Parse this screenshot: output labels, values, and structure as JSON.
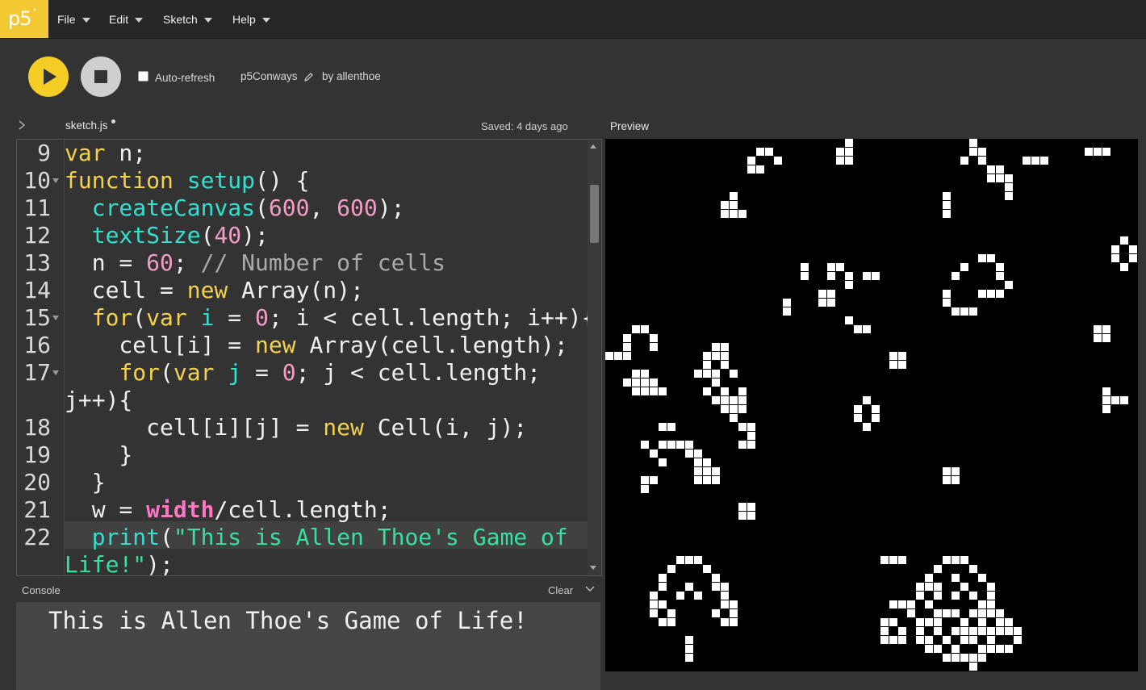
{
  "app": {
    "logo_text": "p5",
    "logo_mark": "*"
  },
  "menu": {
    "file": "File",
    "edit": "Edit",
    "sketch": "Sketch",
    "help": "Help"
  },
  "toolbar": {
    "auto_refresh_label": "Auto-refresh",
    "auto_refresh_checked": false,
    "sketch_name": "p5Conways",
    "author": "by allenthoe"
  },
  "editor": {
    "tab_name": "sketch.js",
    "saved_status": "Saved: 4 days ago",
    "lines": [
      {
        "n": "9",
        "tokens": [
          [
            "kw",
            "var"
          ],
          [
            "pl",
            " n;"
          ]
        ]
      },
      {
        "n": "10",
        "fold": true,
        "tokens": [
          [
            "kw",
            "function"
          ],
          [
            "pl",
            " "
          ],
          [
            "fn",
            "setup"
          ],
          [
            "pl",
            "() {"
          ]
        ]
      },
      {
        "n": "11",
        "tokens": [
          [
            "pl",
            "  "
          ],
          [
            "fn",
            "createCanvas"
          ],
          [
            "pl",
            "("
          ],
          [
            "num",
            "600"
          ],
          [
            "pl",
            ", "
          ],
          [
            "num",
            "600"
          ],
          [
            "pl",
            ");"
          ]
        ]
      },
      {
        "n": "12",
        "tokens": [
          [
            "pl",
            "  "
          ],
          [
            "fn",
            "textSize"
          ],
          [
            "pl",
            "("
          ],
          [
            "num",
            "40"
          ],
          [
            "pl",
            ");"
          ]
        ]
      },
      {
        "n": "13",
        "tokens": [
          [
            "pl",
            "  n = "
          ],
          [
            "num",
            "60"
          ],
          [
            "pl",
            "; "
          ],
          [
            "cm",
            "// Number of cells"
          ]
        ]
      },
      {
        "n": "14",
        "tokens": [
          [
            "pl",
            "  cell = "
          ],
          [
            "kw",
            "new"
          ],
          [
            "pl",
            " Array(n);"
          ]
        ]
      },
      {
        "n": "15",
        "fold": true,
        "tokens": [
          [
            "pl",
            "  "
          ],
          [
            "kw",
            "for"
          ],
          [
            "pl",
            "("
          ],
          [
            "kw",
            "var"
          ],
          [
            "pl",
            " "
          ],
          [
            "var",
            "i"
          ],
          [
            "pl",
            " = "
          ],
          [
            "num",
            "0"
          ],
          [
            "pl",
            "; i < cell.length; i++){"
          ]
        ]
      },
      {
        "n": "16",
        "tokens": [
          [
            "pl",
            "    cell[i] = "
          ],
          [
            "kw",
            "new"
          ],
          [
            "pl",
            " Array(cell.length);"
          ]
        ]
      },
      {
        "n": "17",
        "fold": true,
        "tokens": [
          [
            "pl",
            "    "
          ],
          [
            "kw",
            "for"
          ],
          [
            "pl",
            "("
          ],
          [
            "kw",
            "var"
          ],
          [
            "pl",
            " "
          ],
          [
            "var",
            "j"
          ],
          [
            "pl",
            " = "
          ],
          [
            "num",
            "0"
          ],
          [
            "pl",
            "; j < cell.length;"
          ]
        ]
      },
      {
        "n": "",
        "tokens": [
          [
            "pl",
            "j++){"
          ]
        ]
      },
      {
        "n": "18",
        "tokens": [
          [
            "pl",
            "      cell[i][j] = "
          ],
          [
            "kw",
            "new"
          ],
          [
            "pl",
            " Cell(i, j);"
          ]
        ]
      },
      {
        "n": "19",
        "tokens": [
          [
            "pl",
            "    }"
          ]
        ]
      },
      {
        "n": "20",
        "tokens": [
          [
            "pl",
            "  }"
          ]
        ]
      },
      {
        "n": "21",
        "tokens": [
          [
            "pl",
            "  w = "
          ],
          [
            "bi",
            "width"
          ],
          [
            "pl",
            "/cell.length;"
          ]
        ]
      },
      {
        "n": "22",
        "tokens": [
          [
            "pl",
            "  "
          ],
          [
            "fn",
            "print"
          ],
          [
            "pl",
            "("
          ],
          [
            "str",
            "\"This is Allen Thoe's Game of"
          ]
        ]
      },
      {
        "n": "",
        "tokens": [
          [
            "str",
            "Life!\""
          ],
          [
            "pl",
            ");"
          ]
        ]
      }
    ]
  },
  "console": {
    "title": "Console",
    "clear_label": "Clear",
    "output": "This is Allen Thoe's Game of Life!"
  },
  "preview": {
    "title": "Preview",
    "grid_cells": 60,
    "live_cells": [
      [
        17,
        1
      ],
      [
        18,
        1
      ],
      [
        16,
        2
      ],
      [
        19,
        2
      ],
      [
        16,
        3
      ],
      [
        17,
        3
      ],
      [
        27,
        0
      ],
      [
        26,
        1
      ],
      [
        27,
        1
      ],
      [
        26,
        2
      ],
      [
        27,
        2
      ],
      [
        41,
        0
      ],
      [
        41,
        1
      ],
      [
        42,
        1
      ],
      [
        40,
        2
      ],
      [
        42,
        2
      ],
      [
        43,
        3
      ],
      [
        44,
        3
      ],
      [
        43,
        4
      ],
      [
        44,
        4
      ],
      [
        45,
        4
      ],
      [
        45,
        5
      ],
      [
        45,
        6
      ],
      [
        47,
        2
      ],
      [
        48,
        2
      ],
      [
        49,
        2
      ],
      [
        54,
        1
      ],
      [
        55,
        1
      ],
      [
        56,
        1
      ],
      [
        14,
        6
      ],
      [
        13,
        7
      ],
      [
        14,
        7
      ],
      [
        15,
        8
      ],
      [
        13,
        8
      ],
      [
        14,
        8
      ],
      [
        38,
        6
      ],
      [
        38,
        7
      ],
      [
        38,
        8
      ],
      [
        58,
        11
      ],
      [
        57,
        12
      ],
      [
        59,
        12
      ],
      [
        57,
        13
      ],
      [
        59,
        13
      ],
      [
        58,
        14
      ],
      [
        22,
        14
      ],
      [
        22,
        15
      ],
      [
        25,
        14
      ],
      [
        26,
        14
      ],
      [
        25,
        15
      ],
      [
        27,
        15
      ],
      [
        27,
        16
      ],
      [
        29,
        15
      ],
      [
        30,
        15
      ],
      [
        24,
        17
      ],
      [
        24,
        18
      ],
      [
        25,
        18
      ],
      [
        25,
        17
      ],
      [
        20,
        18
      ],
      [
        20,
        19
      ],
      [
        27,
        20
      ],
      [
        28,
        21
      ],
      [
        29,
        21
      ],
      [
        42,
        13
      ],
      [
        43,
        13
      ],
      [
        40,
        14
      ],
      [
        44,
        14
      ],
      [
        39,
        15
      ],
      [
        44,
        15
      ],
      [
        45,
        16
      ],
      [
        42,
        17
      ],
      [
        43,
        17
      ],
      [
        44,
        17
      ],
      [
        38,
        17
      ],
      [
        38,
        18
      ],
      [
        39,
        19
      ],
      [
        40,
        19
      ],
      [
        41,
        19
      ],
      [
        3,
        21
      ],
      [
        4,
        21
      ],
      [
        2,
        22
      ],
      [
        5,
        22
      ],
      [
        2,
        23
      ],
      [
        5,
        23
      ],
      [
        1,
        24
      ],
      [
        2,
        24
      ],
      [
        0,
        24
      ],
      [
        3,
        26
      ],
      [
        4,
        26
      ],
      [
        2,
        27
      ],
      [
        3,
        27
      ],
      [
        4,
        27
      ],
      [
        5,
        27
      ],
      [
        3,
        28
      ],
      [
        4,
        28
      ],
      [
        5,
        28
      ],
      [
        6,
        28
      ],
      [
        12,
        23
      ],
      [
        13,
        23
      ],
      [
        11,
        24
      ],
      [
        12,
        24
      ],
      [
        13,
        24
      ],
      [
        10,
        26
      ],
      [
        11,
        26
      ],
      [
        12,
        26
      ],
      [
        14,
        26
      ],
      [
        11,
        25
      ],
      [
        13,
        25
      ],
      [
        12,
        27
      ],
      [
        11,
        28
      ],
      [
        13,
        28
      ],
      [
        12,
        29
      ],
      [
        13,
        29
      ],
      [
        14,
        29
      ],
      [
        13,
        30
      ],
      [
        14,
        30
      ],
      [
        15,
        30
      ],
      [
        14,
        31
      ],
      [
        15,
        28
      ],
      [
        15,
        29
      ],
      [
        55,
        21
      ],
      [
        56,
        21
      ],
      [
        55,
        22
      ],
      [
        56,
        22
      ],
      [
        32,
        24
      ],
      [
        33,
        24
      ],
      [
        32,
        25
      ],
      [
        33,
        25
      ],
      [
        56,
        28
      ],
      [
        56,
        29
      ],
      [
        57,
        29
      ],
      [
        58,
        29
      ],
      [
        56,
        30
      ],
      [
        29,
        29
      ],
      [
        28,
        30
      ],
      [
        30,
        30
      ],
      [
        28,
        31
      ],
      [
        30,
        31
      ],
      [
        29,
        32
      ],
      [
        6,
        32
      ],
      [
        7,
        32
      ],
      [
        15,
        32
      ],
      [
        16,
        32
      ],
      [
        16,
        33
      ],
      [
        15,
        34
      ],
      [
        16,
        34
      ],
      [
        4,
        34
      ],
      [
        6,
        34
      ],
      [
        7,
        34
      ],
      [
        8,
        34
      ],
      [
        9,
        34
      ],
      [
        5,
        35
      ],
      [
        9,
        35
      ],
      [
        10,
        35
      ],
      [
        6,
        36
      ],
      [
        10,
        36
      ],
      [
        11,
        36
      ],
      [
        10,
        37
      ],
      [
        11,
        37
      ],
      [
        12,
        37
      ],
      [
        11,
        38
      ],
      [
        12,
        38
      ],
      [
        10,
        38
      ],
      [
        4,
        38
      ],
      [
        5,
        38
      ],
      [
        4,
        39
      ],
      [
        38,
        37
      ],
      [
        39,
        37
      ],
      [
        38,
        38
      ],
      [
        39,
        38
      ],
      [
        15,
        41
      ],
      [
        16,
        41
      ],
      [
        15,
        42
      ],
      [
        16,
        42
      ],
      [
        8,
        47
      ],
      [
        9,
        47
      ],
      [
        10,
        47
      ],
      [
        7,
        48
      ],
      [
        11,
        48
      ],
      [
        6,
        49
      ],
      [
        12,
        49
      ],
      [
        6,
        50
      ],
      [
        9,
        50
      ],
      [
        12,
        50
      ],
      [
        13,
        50
      ],
      [
        5,
        51
      ],
      [
        8,
        51
      ],
      [
        10,
        51
      ],
      [
        13,
        51
      ],
      [
        5,
        52
      ],
      [
        6,
        52
      ],
      [
        13,
        52
      ],
      [
        14,
        52
      ],
      [
        5,
        53
      ],
      [
        7,
        53
      ],
      [
        12,
        53
      ],
      [
        14,
        53
      ],
      [
        6,
        54
      ],
      [
        7,
        54
      ],
      [
        13,
        54
      ],
      [
        14,
        54
      ],
      [
        9,
        56
      ],
      [
        9,
        57
      ],
      [
        9,
        58
      ],
      [
        31,
        47
      ],
      [
        32,
        47
      ],
      [
        33,
        47
      ],
      [
        38,
        47
      ],
      [
        39,
        47
      ],
      [
        40,
        47
      ],
      [
        37,
        48
      ],
      [
        41,
        48
      ],
      [
        36,
        49
      ],
      [
        39,
        49
      ],
      [
        42,
        49
      ],
      [
        35,
        50
      ],
      [
        36,
        50
      ],
      [
        37,
        50
      ],
      [
        40,
        50
      ],
      [
        43,
        50
      ],
      [
        35,
        51
      ],
      [
        37,
        51
      ],
      [
        39,
        51
      ],
      [
        41,
        51
      ],
      [
        43,
        51
      ],
      [
        32,
        52
      ],
      [
        33,
        52
      ],
      [
        34,
        52
      ],
      [
        36,
        52
      ],
      [
        42,
        52
      ],
      [
        43,
        52
      ],
      [
        34,
        53
      ],
      [
        37,
        53
      ],
      [
        38,
        53
      ],
      [
        39,
        53
      ],
      [
        41,
        53
      ],
      [
        42,
        53
      ],
      [
        43,
        53
      ],
      [
        44,
        53
      ],
      [
        31,
        54
      ],
      [
        32,
        54
      ],
      [
        35,
        54
      ],
      [
        36,
        54
      ],
      [
        37,
        54
      ],
      [
        40,
        54
      ],
      [
        42,
        54
      ],
      [
        44,
        54
      ],
      [
        45,
        54
      ],
      [
        31,
        55
      ],
      [
        33,
        55
      ],
      [
        35,
        55
      ],
      [
        37,
        55
      ],
      [
        39,
        55
      ],
      [
        40,
        55
      ],
      [
        41,
        55
      ],
      [
        42,
        55
      ],
      [
        43,
        55
      ],
      [
        44,
        55
      ],
      [
        45,
        55
      ],
      [
        46,
        55
      ],
      [
        31,
        56
      ],
      [
        32,
        56
      ],
      [
        33,
        56
      ],
      [
        35,
        56
      ],
      [
        36,
        56
      ],
      [
        38,
        56
      ],
      [
        40,
        56
      ],
      [
        41,
        56
      ],
      [
        43,
        56
      ],
      [
        46,
        56
      ],
      [
        36,
        57
      ],
      [
        37,
        57
      ],
      [
        39,
        57
      ],
      [
        42,
        57
      ],
      [
        43,
        57
      ],
      [
        44,
        57
      ],
      [
        45,
        57
      ],
      [
        38,
        58
      ],
      [
        39,
        58
      ],
      [
        40,
        58
      ],
      [
        41,
        58
      ],
      [
        42,
        58
      ],
      [
        41,
        59
      ]
    ]
  }
}
